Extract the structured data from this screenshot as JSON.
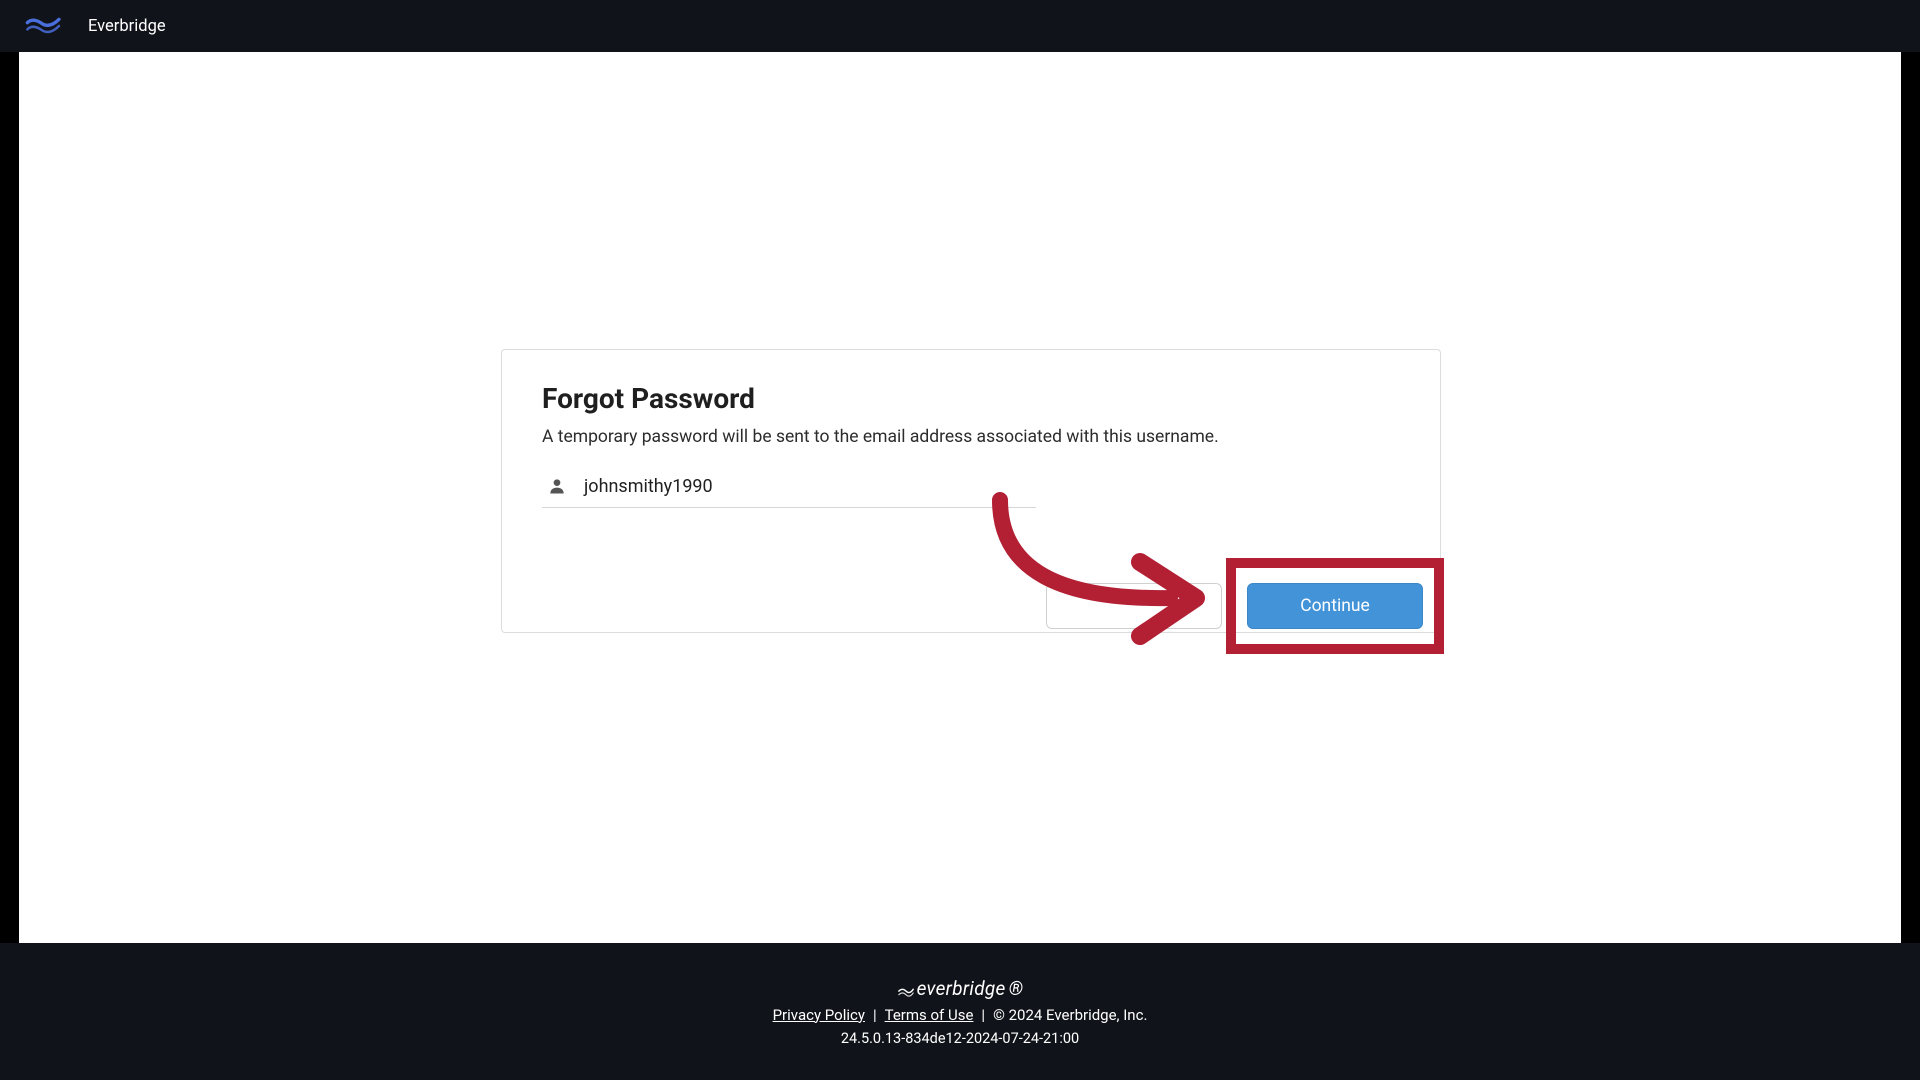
{
  "header": {
    "brand": "Everbridge"
  },
  "card": {
    "title": "Forgot Password",
    "description": "A temporary password will be sent to the email address associated with this username.",
    "username": "johnsmithy1990",
    "continue_label": "Continue"
  },
  "footer": {
    "brand": "everbridge",
    "privacy_label": "Privacy Policy",
    "terms_label": "Terms of Use",
    "copyright": "©  2024 Everbridge, Inc.",
    "version": "24.5.0.13-834de12-2024-07-24-21:00",
    "separator": "|"
  },
  "colors": {
    "accent": "#4393d8",
    "highlight": "#b32034"
  }
}
